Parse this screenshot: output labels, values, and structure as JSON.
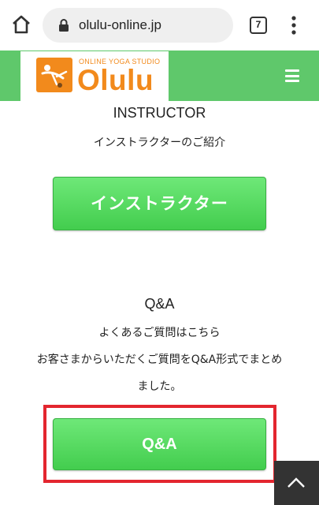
{
  "browser": {
    "url": "olulu-online.jp",
    "tab_count": "7"
  },
  "site": {
    "logo_subtitle": "ONLINE YOGA STUDIO",
    "logo_name": "Olulu",
    "brand_color": "#5fc86b",
    "logo_color": "#f28a1c"
  },
  "instructor": {
    "title": "INSTRUCTOR",
    "desc": "インストラクターのご紹介",
    "button_label": "インストラクター"
  },
  "qa": {
    "title": "Q&A",
    "desc_line1": "よくあるご質問はこちら",
    "desc_line2": "お客さまからいただくご質問をQ&A形式でまとめ",
    "desc_line3": "ました。",
    "button_label": "Q&A"
  },
  "icons": {
    "home": "home-icon",
    "lock": "lock-icon",
    "menu": "more-vert-icon",
    "hamburger": "hamburger-menu-icon",
    "scroll_top": "chevron-up-icon"
  },
  "highlight_color": "#e3262f"
}
